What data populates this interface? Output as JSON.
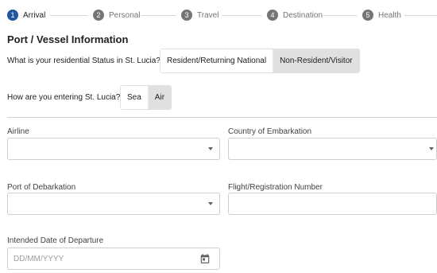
{
  "stepper": {
    "steps": [
      {
        "number": "1",
        "label": "Arrival",
        "active": true
      },
      {
        "number": "2",
        "label": "Personal",
        "active": false
      },
      {
        "number": "3",
        "label": "Travel",
        "active": false
      },
      {
        "number": "4",
        "label": "Destination",
        "active": false
      },
      {
        "number": "5",
        "label": "Health",
        "active": false
      }
    ]
  },
  "section": {
    "title": "Port / Vessel Information"
  },
  "residential_status": {
    "question": "What is your residential Status in St. Lucia?",
    "options": [
      "Resident/Returning National",
      "Non-Resident/Visitor"
    ],
    "selected": "Non-Resident/Visitor"
  },
  "entry_mode": {
    "question": "How are you entering St. Lucia?",
    "options": [
      "Sea",
      "Air"
    ],
    "selected": "Air"
  },
  "fields": {
    "airline": {
      "label": "Airline",
      "value": ""
    },
    "country_of_embarkation": {
      "label": "Country of Embarkation",
      "value": ""
    },
    "port_of_debarkation": {
      "label": "Port of Debarkation",
      "value": ""
    },
    "flight_registration_number": {
      "label": "Flight/Registration Number",
      "value": ""
    },
    "intended_departure": {
      "label": "Intended Date of Departure",
      "placeholder": "DD/MM/YYYY"
    }
  },
  "colors": {
    "accent": "#1e56a0",
    "selected_bg": "#e0e0e0",
    "inactive_step": "#757575"
  }
}
